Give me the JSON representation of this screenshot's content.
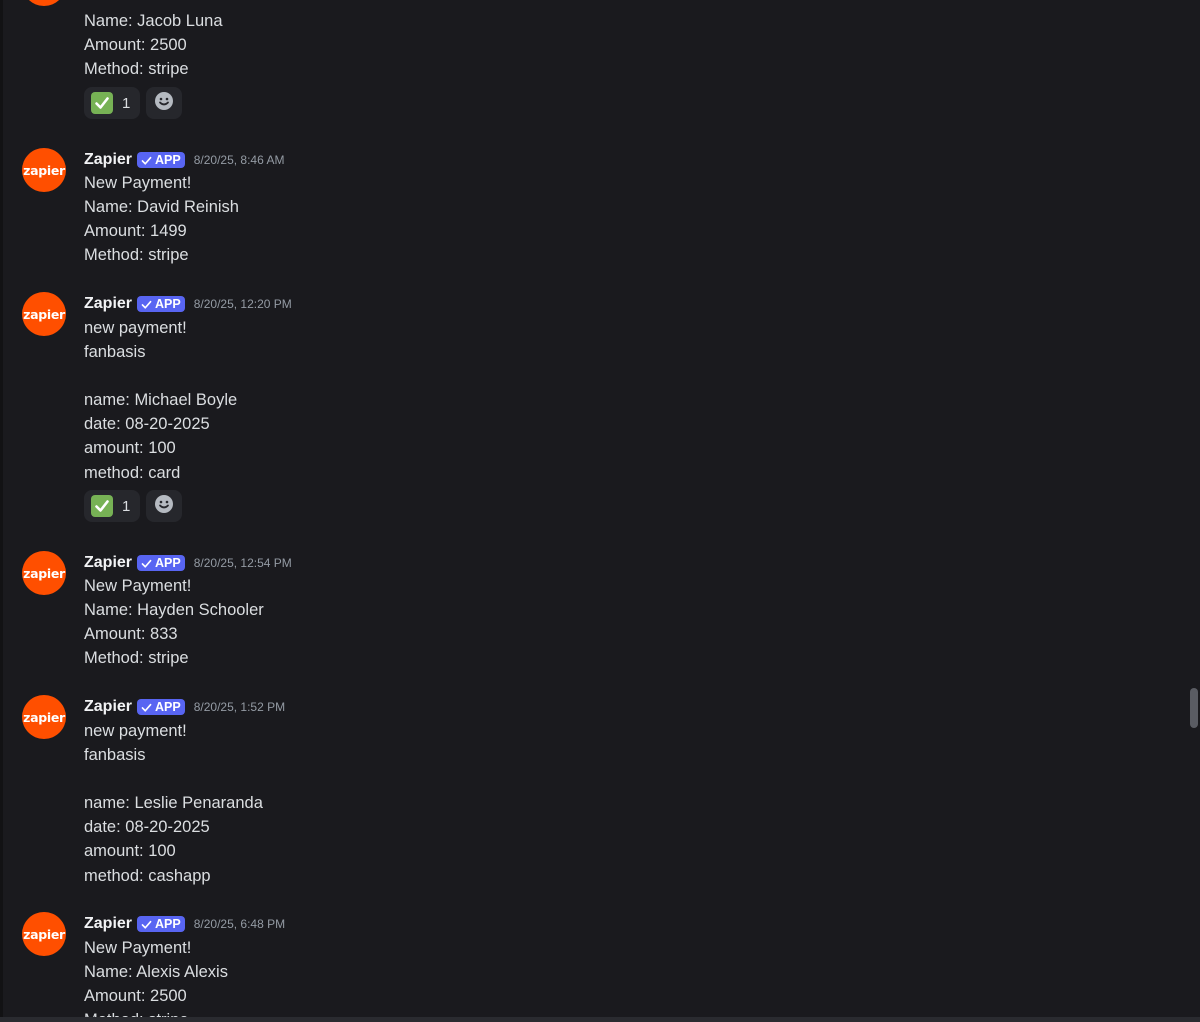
{
  "app": {
    "avatar_label": "zapier",
    "author": "Zapier",
    "app_tag": "APP"
  },
  "colors": {
    "background": "#1a1a1e",
    "avatar": "#ff4f00",
    "app_tag": "#5865f2",
    "text": "#dbdee1",
    "timestamp": "#949ba4"
  },
  "messages": [
    {
      "partial_top": true,
      "lines": [
        "Name: Jacob Luna",
        "Amount: 2500",
        "Method: stripe"
      ],
      "reaction": {
        "emoji": "white-check-mark",
        "count": "1"
      }
    },
    {
      "author": "Zapier",
      "tag": "APP",
      "timestamp": "8/20/25, 8:46 AM",
      "lines": [
        "New Payment!",
        "Name: David Reinish",
        "Amount: 1499",
        "Method: stripe"
      ]
    },
    {
      "author": "Zapier",
      "tag": "APP",
      "timestamp": "8/20/25, 12:20 PM",
      "lines": [
        "new payment!",
        "fanbasis",
        "",
        "name: Michael Boyle",
        "date: 08-20-2025",
        "amount: 100",
        "method: card"
      ],
      "reaction": {
        "emoji": "white-check-mark",
        "count": "1"
      }
    },
    {
      "author": "Zapier",
      "tag": "APP",
      "timestamp": "8/20/25, 12:54 PM",
      "lines": [
        "New Payment!",
        "Name: Hayden Schooler",
        "Amount: 833",
        "Method: stripe"
      ]
    },
    {
      "author": "Zapier",
      "tag": "APP",
      "timestamp": "8/20/25, 1:52 PM",
      "lines": [
        "new payment!",
        "fanbasis",
        "",
        "name: Leslie Penaranda",
        "date: 08-20-2025",
        "amount: 100",
        "method: cashapp"
      ]
    },
    {
      "author": "Zapier",
      "tag": "APP",
      "timestamp": "8/20/25, 6:48 PM",
      "lines": [
        "New Payment!",
        "Name: Alexis Alexis",
        "Amount: 2500",
        "Method: stripe"
      ],
      "partial_bottom": true
    }
  ]
}
